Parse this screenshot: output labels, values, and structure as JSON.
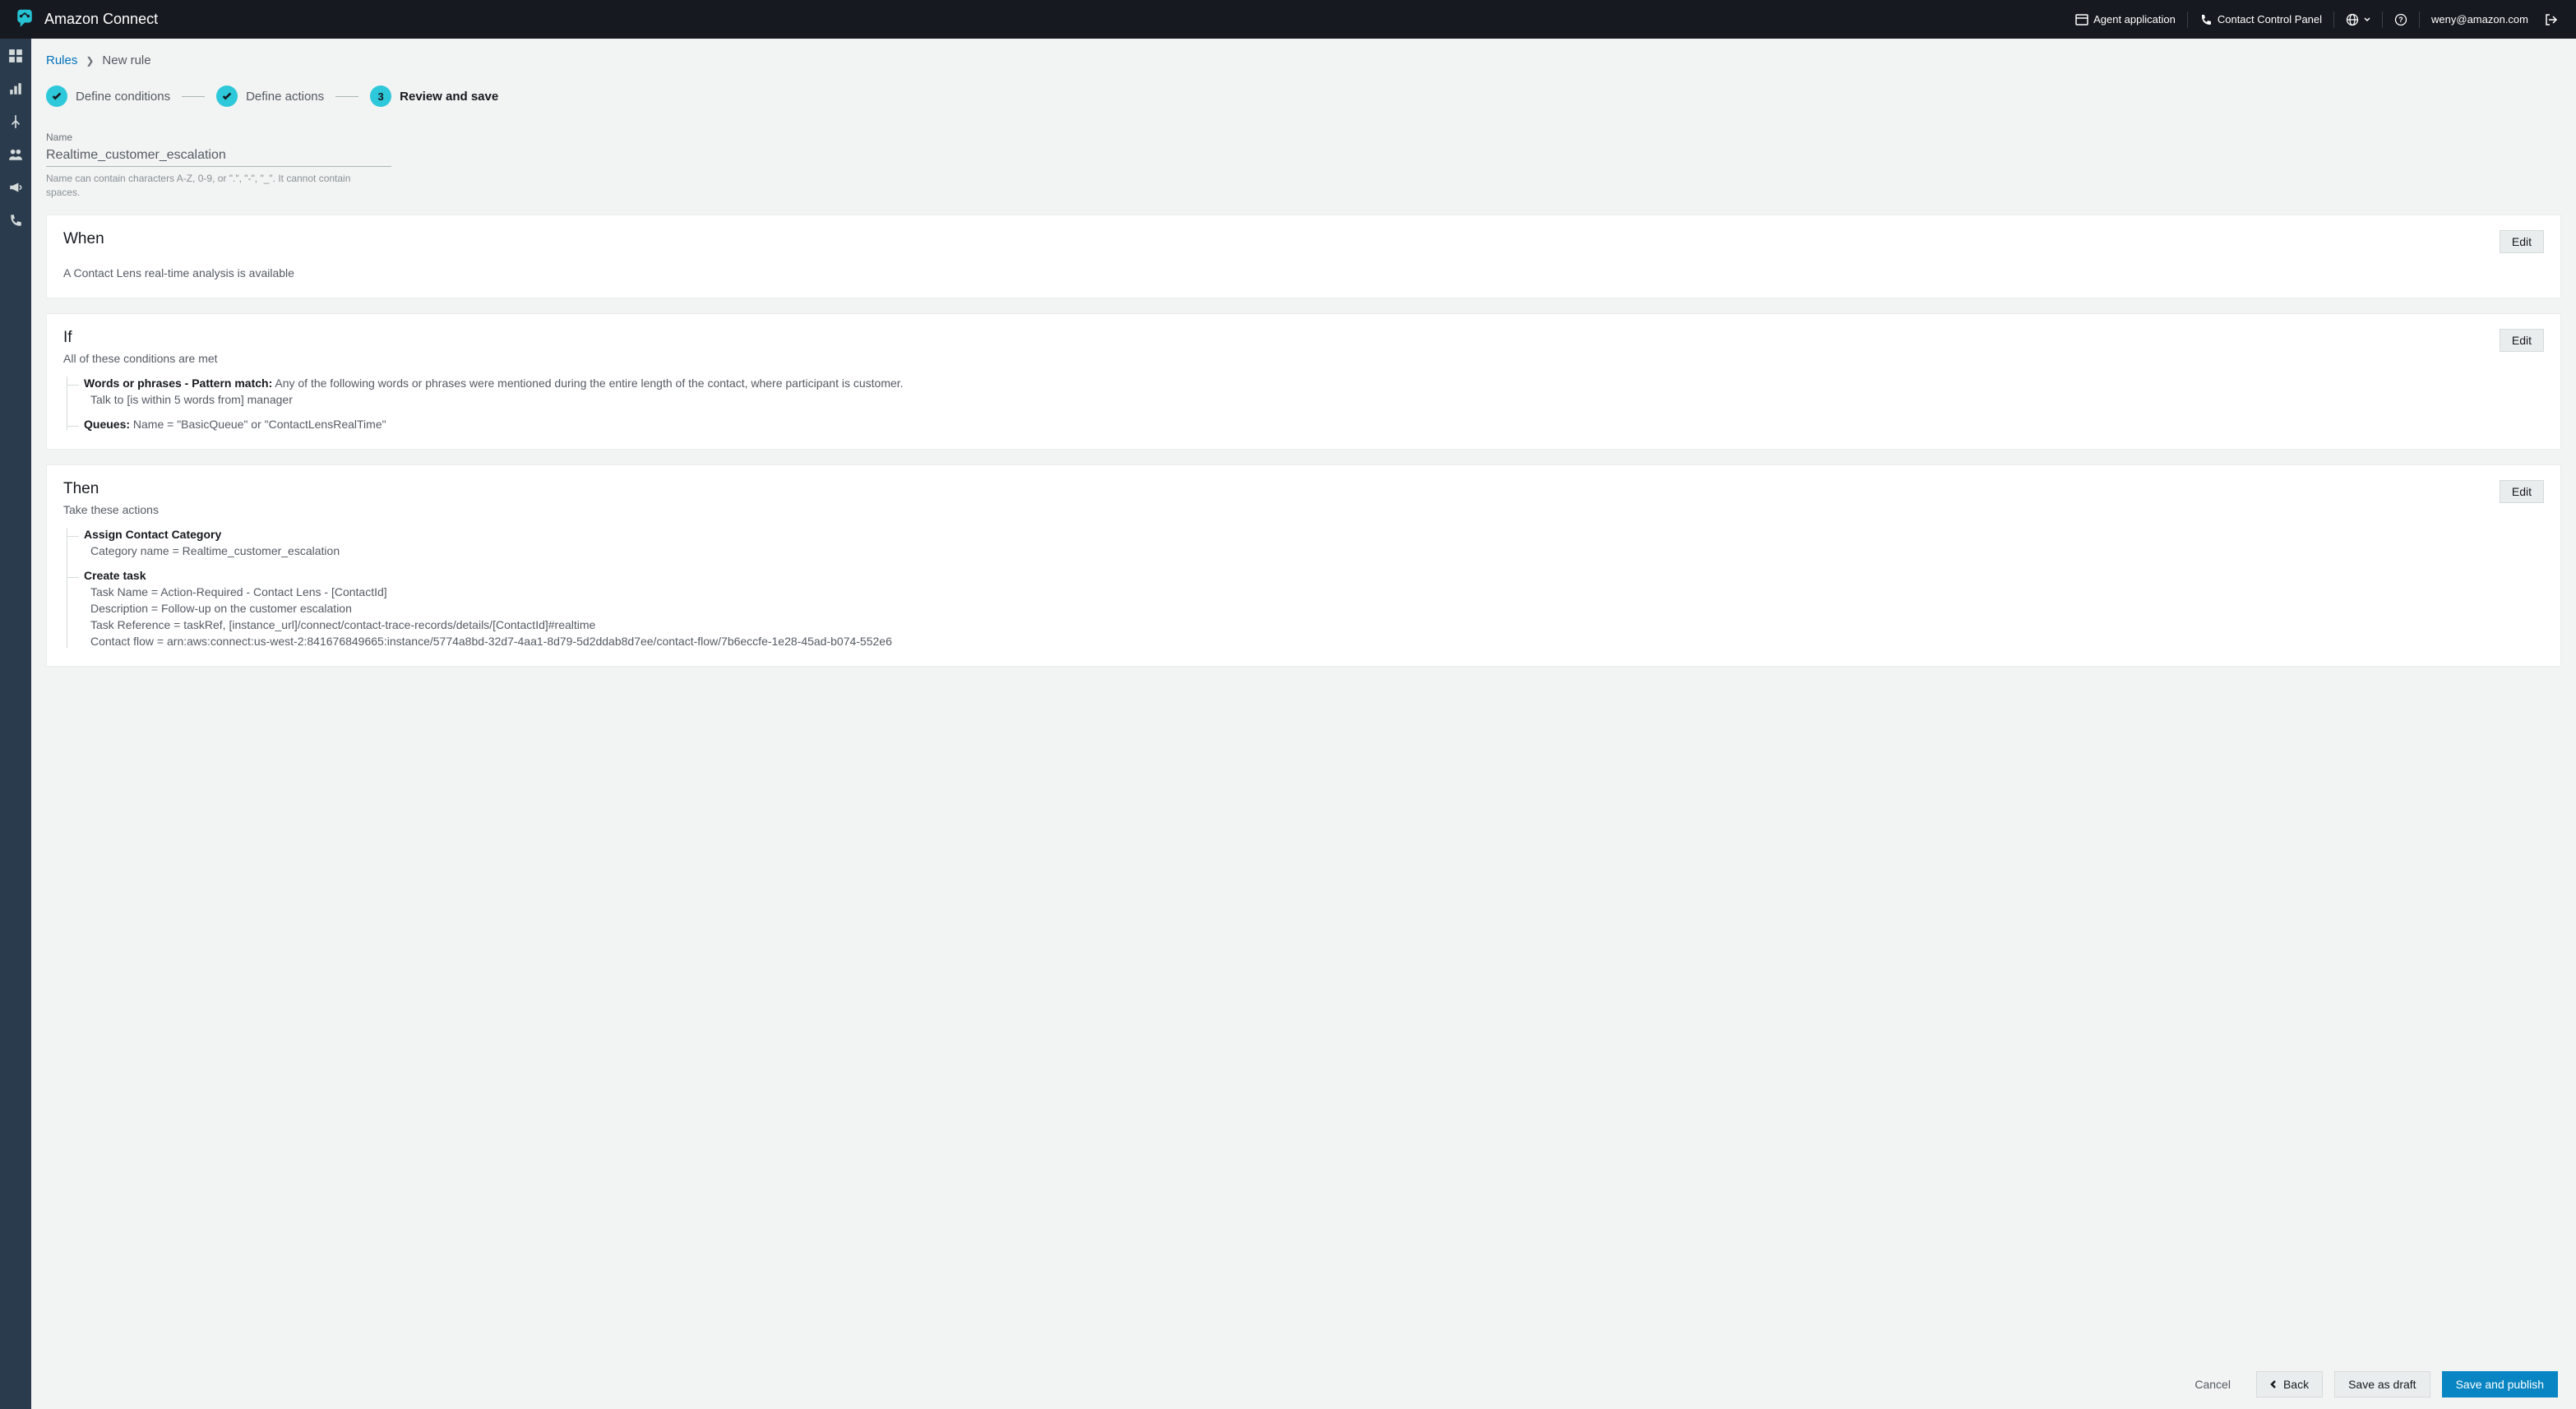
{
  "topbar": {
    "title": "Amazon Connect",
    "agentApp": "Agent application",
    "ccp": "Contact Control Panel",
    "user": "weny@amazon.com"
  },
  "breadcrumb": {
    "root": "Rules",
    "current": "New rule"
  },
  "steps": {
    "s1": "Define conditions",
    "s2": "Define actions",
    "s3num": "3",
    "s3": "Review and save"
  },
  "name": {
    "label": "Name",
    "value": "Realtime_customer_escalation",
    "hint": "Name can contain characters A-Z, 0-9, or \".\", \"-\", \"_\". It cannot contain spaces."
  },
  "when": {
    "title": "When",
    "text": "A Contact Lens real-time analysis is available",
    "edit": "Edit"
  },
  "if": {
    "title": "If",
    "subtitle": "All of these conditions are met",
    "edit": "Edit",
    "c1_label": "Words or phrases - Pattern match:",
    "c1_text": " Any of the following words or phrases were mentioned during the entire length of the contact, where participant is customer.",
    "c1_detail": "Talk to [is within 5 words from] manager",
    "c2_label": "Queues:",
    "c2_text": " Name = \"BasicQueue\" or \"ContactLensRealTime\""
  },
  "then": {
    "title": "Then",
    "subtitle": "Take these actions",
    "edit": "Edit",
    "a1_label": "Assign Contact Category",
    "a1_detail": "Category name = Realtime_customer_escalation",
    "a2_label": "Create task",
    "a2_d1": "Task Name = Action-Required - Contact Lens - [ContactId]",
    "a2_d2": "Description = Follow-up on the customer escalation",
    "a2_d3": "Task Reference = taskRef, [instance_url]/connect/contact-trace-records/details/[ContactId]#realtime",
    "a2_d4": "Contact flow = arn:aws:connect:us-west-2:841676849665:instance/5774a8bd-32d7-4aa1-8d79-5d2ddab8d7ee/contact-flow/7b6eccfe-1e28-45ad-b074-552e6"
  },
  "footer": {
    "cancel": "Cancel",
    "back": "Back",
    "draft": "Save as draft",
    "publish": "Save and publish"
  }
}
